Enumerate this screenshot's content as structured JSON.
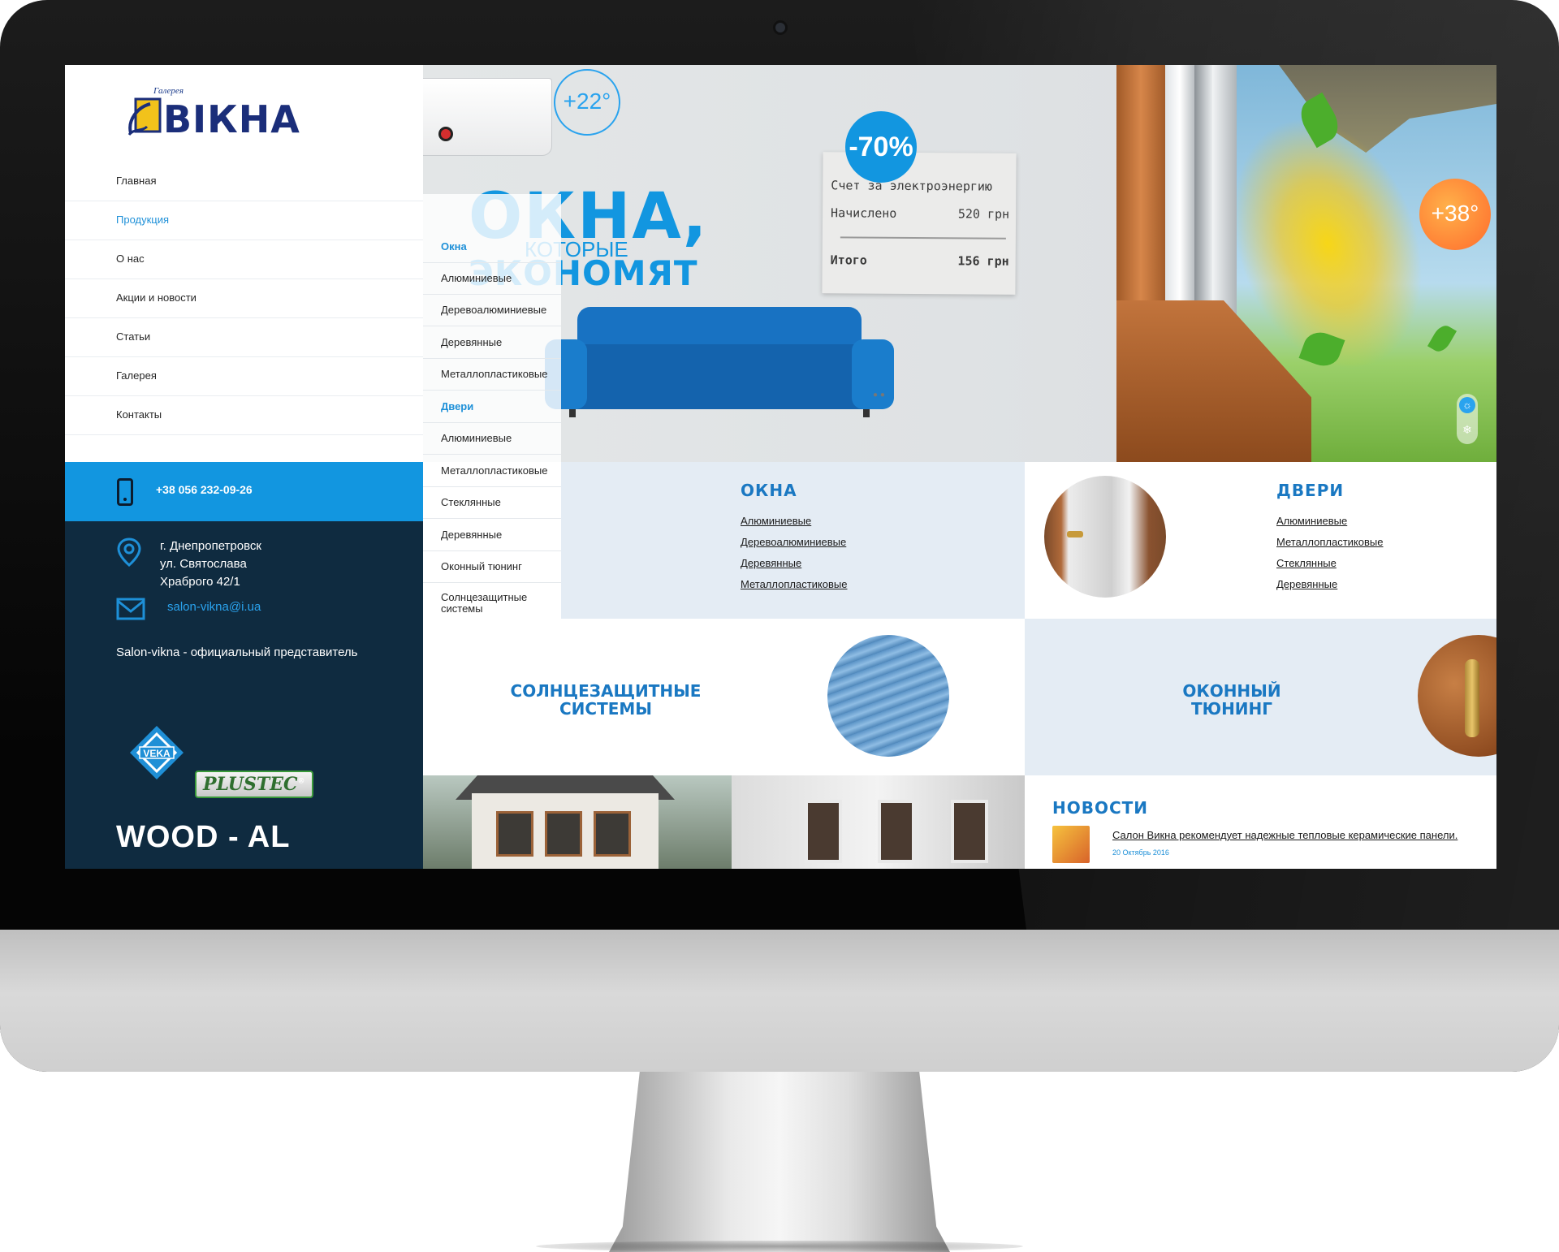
{
  "brand": {
    "kicker": "Галерея",
    "name": "ВIКНА"
  },
  "nav": {
    "items": [
      {
        "label": "Главная",
        "active": false
      },
      {
        "label": "Продукция",
        "active": true
      },
      {
        "label": "О нас",
        "active": false
      },
      {
        "label": "Акции и новости",
        "active": false
      },
      {
        "label": "Статьи",
        "active": false
      },
      {
        "label": "Галерея",
        "active": false
      },
      {
        "label": "Контакты",
        "active": false
      }
    ]
  },
  "contacts": {
    "phone": "+38 056 232-09-26",
    "address_line1": "г. Днепропетровск",
    "address_line2": "ул. Святослава",
    "address_line3": "Храброго 42/1",
    "email": "salon-vikna@i.ua",
    "representative": "Salon-vikna - официальный представитель"
  },
  "partners": {
    "veka": "VEKA",
    "plustec": "PLUSTEC",
    "plustec_mark": "®",
    "woodal": "WOOD - AL"
  },
  "hero": {
    "indoor_temp": "+22°",
    "slogan_line1": "ОКНА,",
    "slogan_line2": "КОТОРЫЕ",
    "slogan_line3": "ЭКОНОМЯТ",
    "discount": "-70%",
    "receipt_title": "Счет за электроэнергию",
    "receipt_row1_label": "Начислено",
    "receipt_row1_value": "520 грн",
    "receipt_row2_label": "Итого",
    "receipt_row2_value": "156 грн",
    "outdoor_temp": "+38°",
    "toggle_sun": "☼",
    "toggle_snow": "❄"
  },
  "submenu": {
    "items": [
      {
        "label": "Окна",
        "head": true
      },
      {
        "label": "Алюминиевые",
        "head": false
      },
      {
        "label": "Деревоалюминиевые",
        "head": false
      },
      {
        "label": "Деревянные",
        "head": false
      },
      {
        "label": "Металлопластиковые",
        "head": false
      },
      {
        "label": "Двери",
        "head": true
      },
      {
        "label": "Алюминиевые",
        "head": false
      },
      {
        "label": "Металлопластиковые",
        "head": false
      },
      {
        "label": "Стеклянные",
        "head": false
      },
      {
        "label": "Деревянные",
        "head": false
      },
      {
        "label": "Оконный тюнинг",
        "head": false
      },
      {
        "label": "Солнцезащитные системы",
        "head": false
      }
    ]
  },
  "cards": {
    "okna": {
      "title": "ОКНА",
      "links": [
        "Алюминиевые",
        "Деревоалюминиевые",
        "Деревянные",
        "Металлопластиковые"
      ]
    },
    "dveri": {
      "title": "ДВЕРИ",
      "links": [
        "Алюминиевые",
        "Металлопластиковые",
        "Стеклянные",
        "Деревянные"
      ]
    },
    "sun": {
      "line1": "СОЛНЦЕЗАЩИТНЫЕ",
      "line2": "СИСТЕМЫ"
    },
    "tuning": {
      "line1": "ОКОННЫЙ",
      "line2": "ТЮНИНГ"
    }
  },
  "news": {
    "title": "НОВОСТИ",
    "item_text": "Салон Викна рекомендует надежные тепловые керамические панели.",
    "item_date": "20 Октябрь 2016"
  }
}
